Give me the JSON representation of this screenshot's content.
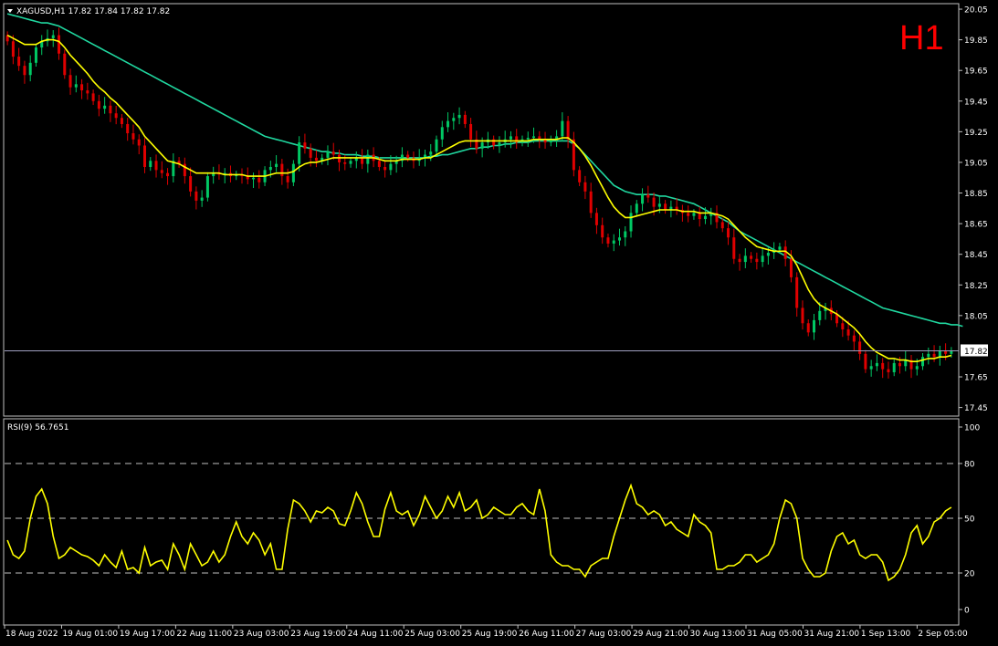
{
  "header": {
    "symbol_line": "XAGUSD,H1  17.82 17.84 17.82 17.82",
    "timeframe_label": "H1",
    "rsi_label": "RSI(9) 56.7651",
    "current_price": "17.82"
  },
  "colors": {
    "background": "#000000",
    "bull_candle": "#00c864",
    "bear_candle": "#e00000",
    "ma_fast": "#ffff00",
    "ma_slow": "#20d8a0",
    "rsi_line": "#ffff00",
    "price_line": "#a0a0c0",
    "timeframe_label": "#ff0000"
  },
  "chart_data": {
    "type": "candlestick",
    "price_axis": {
      "ticks": [
        "20.05",
        "19.85",
        "19.65",
        "19.45",
        "19.25",
        "19.05",
        "18.85",
        "18.65",
        "18.45",
        "18.25",
        "18.05",
        "17.85",
        "17.65",
        "17.45"
      ],
      "ylim": [
        17.4,
        20.08
      ]
    },
    "rsi_axis": {
      "ticks": [
        "100",
        "80",
        "50",
        "20",
        "0"
      ],
      "levels": [
        80,
        50,
        20
      ],
      "ylim": [
        0,
        100
      ]
    },
    "x_labels": [
      "18 Aug 2022",
      "19 Aug 01:00",
      "19 Aug 17:00",
      "22 Aug 11:00",
      "23 Aug 03:00",
      "23 Aug 19:00",
      "24 Aug 11:00",
      "25 Aug 03:00",
      "25 Aug 19:00",
      "26 Aug 11:00",
      "27 Aug 03:00",
      "29 Aug 21:00",
      "30 Aug 13:00",
      "31 Aug 05:00",
      "31 Aug 21:00",
      "1 Sep 13:00",
      "2 Sep 05:00"
    ],
    "closes": [
      19.84,
      19.74,
      19.68,
      19.62,
      19.7,
      19.8,
      19.84,
      19.86,
      19.88,
      19.76,
      19.62,
      19.54,
      19.56,
      19.52,
      19.5,
      19.45,
      19.4,
      19.42,
      19.37,
      19.34,
      19.3,
      19.24,
      19.2,
      19.16,
      19.02,
      19.06,
      19.0,
      18.98,
      18.96,
      19.06,
      19.04,
      18.96,
      18.86,
      18.8,
      18.82,
      18.96,
      18.98,
      18.97,
      18.98,
      18.96,
      18.97,
      18.96,
      18.94,
      18.95,
      18.92,
      19.0,
      19.02,
      19.04,
      18.96,
      18.92,
      19.04,
      19.18,
      19.14,
      19.08,
      19.06,
      19.08,
      19.12,
      19.1,
      19.05,
      19.04,
      19.06,
      19.08,
      19.04,
      19.1,
      19.06,
      19.02,
      19.0,
      19.04,
      19.06,
      19.1,
      19.08,
      19.06,
      19.08,
      19.1,
      19.12,
      19.2,
      19.28,
      19.32,
      19.34,
      19.36,
      19.3,
      19.2,
      19.14,
      19.18,
      19.2,
      19.16,
      19.18,
      19.2,
      19.22,
      19.18,
      19.2,
      19.21,
      19.22,
      19.2,
      19.18,
      19.2,
      19.22,
      19.32,
      19.2,
      19.0,
      18.92,
      18.86,
      18.72,
      18.64,
      18.56,
      18.52,
      18.54,
      18.56,
      18.6,
      18.72,
      18.78,
      18.84,
      18.82,
      18.76,
      18.78,
      18.74,
      18.76,
      18.74,
      18.72,
      18.7,
      18.72,
      18.68,
      18.7,
      18.72,
      18.66,
      18.62,
      18.56,
      18.42,
      18.4,
      18.44,
      18.42,
      18.4,
      18.44,
      18.46,
      18.48,
      18.5,
      18.42,
      18.3,
      18.1,
      18.0,
      17.94,
      18.02,
      18.08,
      18.1,
      18.06,
      18.0,
      17.96,
      17.92,
      17.88,
      17.8,
      17.7,
      17.72,
      17.74,
      17.7,
      17.68,
      17.74,
      17.72,
      17.76,
      17.7,
      17.72,
      17.78,
      17.8,
      17.78,
      17.82,
      17.8,
      17.82
    ],
    "ma_fast": [
      19.88,
      19.86,
      19.84,
      19.82,
      19.82,
      19.82,
      19.84,
      19.85,
      19.85,
      19.84,
      19.8,
      19.75,
      19.71,
      19.67,
      19.63,
      19.58,
      19.54,
      19.51,
      19.47,
      19.44,
      19.4,
      19.36,
      19.32,
      19.28,
      19.22,
      19.18,
      19.14,
      19.1,
      19.06,
      19.05,
      19.04,
      19.02,
      19.0,
      18.98,
      18.98,
      18.98,
      18.98,
      18.98,
      18.97,
      18.97,
      18.97,
      18.97,
      18.96,
      18.96,
      18.96,
      18.96,
      18.97,
      18.98,
      18.98,
      18.98,
      18.99,
      19.02,
      19.04,
      19.05,
      19.05,
      19.06,
      19.07,
      19.08,
      19.08,
      19.08,
      19.08,
      19.08,
      19.08,
      19.08,
      19.08,
      19.07,
      19.06,
      19.06,
      19.06,
      19.07,
      19.07,
      19.07,
      19.07,
      19.08,
      19.08,
      19.1,
      19.12,
      19.14,
      19.16,
      19.18,
      19.19,
      19.19,
      19.19,
      19.19,
      19.19,
      19.19,
      19.19,
      19.19,
      19.19,
      19.19,
      19.19,
      19.19,
      19.2,
      19.2,
      19.2,
      19.2,
      19.2,
      19.21,
      19.21,
      19.18,
      19.14,
      19.09,
      19.03,
      18.96,
      18.89,
      18.82,
      18.76,
      18.72,
      18.69,
      18.69,
      18.7,
      18.71,
      18.72,
      18.73,
      18.74,
      18.74,
      18.74,
      18.74,
      18.73,
      18.73,
      18.73,
      18.72,
      18.72,
      18.72,
      18.71,
      18.7,
      18.68,
      18.64,
      18.6,
      18.56,
      18.53,
      18.5,
      18.49,
      18.48,
      18.47,
      18.47,
      18.47,
      18.44,
      18.38,
      18.3,
      18.22,
      18.16,
      18.12,
      18.1,
      18.08,
      18.06,
      18.03,
      18.0,
      17.97,
      17.93,
      17.88,
      17.84,
      17.81,
      17.79,
      17.77,
      17.77,
      17.76,
      17.76,
      17.75,
      17.75,
      17.76,
      17.77,
      17.77,
      17.78,
      17.78,
      17.79
    ],
    "ma_slow": [
      20.02,
      20.01,
      20.0,
      19.99,
      19.98,
      19.97,
      19.96,
      19.96,
      19.95,
      19.94,
      19.92,
      19.9,
      19.88,
      19.86,
      19.84,
      19.82,
      19.8,
      19.78,
      19.76,
      19.74,
      19.72,
      19.7,
      19.68,
      19.66,
      19.64,
      19.62,
      19.6,
      19.58,
      19.56,
      19.54,
      19.52,
      19.5,
      19.48,
      19.46,
      19.44,
      19.42,
      19.4,
      19.38,
      19.36,
      19.34,
      19.32,
      19.3,
      19.28,
      19.26,
      19.24,
      19.22,
      19.21,
      19.2,
      19.19,
      19.18,
      19.17,
      19.16,
      19.15,
      19.14,
      19.13,
      19.12,
      19.12,
      19.11,
      19.11,
      19.1,
      19.1,
      19.1,
      19.09,
      19.09,
      19.09,
      19.08,
      19.08,
      19.08,
      19.08,
      19.08,
      19.08,
      19.08,
      19.08,
      19.08,
      19.09,
      19.09,
      19.1,
      19.1,
      19.11,
      19.12,
      19.13,
      19.14,
      19.14,
      19.15,
      19.15,
      19.16,
      19.16,
      19.17,
      19.17,
      19.18,
      19.18,
      19.18,
      19.19,
      19.19,
      19.19,
      19.19,
      19.19,
      19.19,
      19.19,
      19.17,
      19.14,
      19.1,
      19.06,
      19.02,
      18.98,
      18.94,
      18.9,
      18.88,
      18.86,
      18.85,
      18.84,
      18.84,
      18.84,
      18.84,
      18.83,
      18.83,
      18.82,
      18.81,
      18.8,
      18.79,
      18.78,
      18.76,
      18.74,
      18.72,
      18.7,
      18.68,
      18.66,
      18.63,
      18.6,
      18.58,
      18.56,
      18.54,
      18.52,
      18.5,
      18.48,
      18.46,
      18.44,
      18.42,
      18.4,
      18.38,
      18.36,
      18.34,
      18.32,
      18.3,
      18.28,
      18.26,
      18.24,
      18.22,
      18.2,
      18.18,
      18.16,
      18.14,
      18.12,
      18.1,
      18.09,
      18.08,
      18.07,
      18.06,
      18.05,
      18.04,
      18.03,
      18.02,
      18.01,
      18.0,
      18.0,
      17.99,
      17.99,
      17.98
    ],
    "rsi": [
      38,
      30,
      28,
      32,
      50,
      62,
      66,
      58,
      40,
      28,
      30,
      34,
      32,
      30,
      29,
      27,
      24,
      30,
      26,
      23,
      32,
      22,
      23,
      20,
      34,
      24,
      26,
      27,
      22,
      36,
      30,
      22,
      36,
      30,
      24,
      26,
      32,
      26,
      30,
      40,
      48,
      40,
      36,
      42,
      38,
      30,
      36,
      22,
      22,
      44,
      60,
      58,
      54,
      48,
      54,
      53,
      56,
      54,
      47,
      46,
      54,
      64,
      58,
      48,
      40,
      40,
      55,
      64,
      54,
      52,
      54,
      46,
      52,
      62,
      56,
      50,
      54,
      62,
      56,
      64,
      54,
      56,
      60,
      50,
      52,
      56,
      54,
      52,
      52,
      56,
      58,
      54,
      52,
      66,
      54,
      30,
      26,
      24,
      24,
      22,
      22,
      18,
      24,
      26,
      28,
      28,
      40,
      50,
      60,
      68,
      58,
      56,
      52,
      54,
      52,
      46,
      48,
      44,
      42,
      40,
      52,
      48,
      46,
      42,
      22,
      22,
      24,
      24,
      26,
      30,
      30,
      26,
      28,
      30,
      36,
      50,
      60,
      58,
      50,
      28,
      22,
      18,
      18,
      20,
      32,
      40,
      42,
      36,
      38,
      30,
      28,
      30,
      30,
      26,
      16,
      18,
      22,
      30,
      42,
      46,
      36,
      40,
      48,
      50,
      54,
      56
    ]
  }
}
